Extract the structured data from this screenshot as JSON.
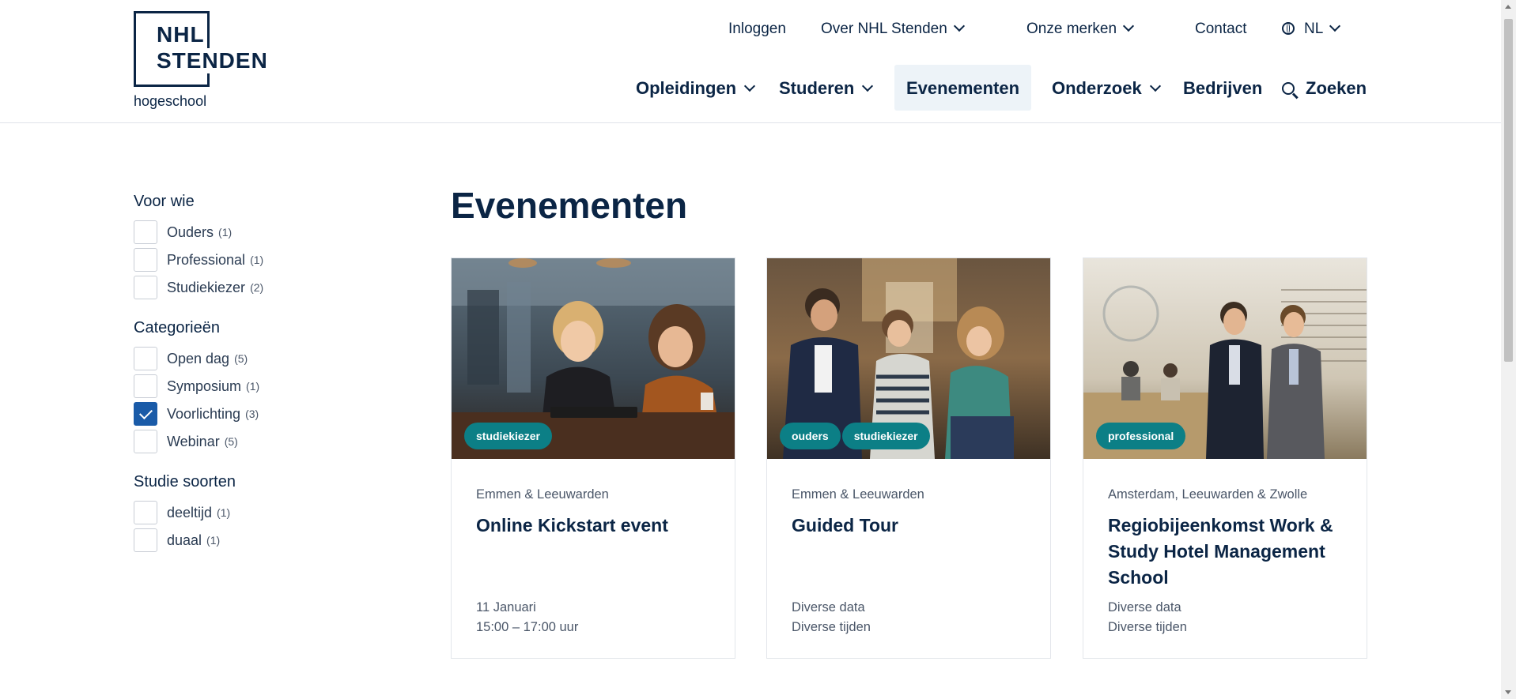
{
  "brand": {
    "line1": "NHL",
    "line2": "STENDEN",
    "sub": "hogeschool",
    "color": "#0b2545"
  },
  "topnav": {
    "login": "Inloggen",
    "about": "Over NHL Stenden",
    "brands": "Onze merken",
    "contact": "Contact",
    "language": "NL"
  },
  "mainnav": {
    "items": [
      {
        "label": "Opleidingen",
        "dropdown": true
      },
      {
        "label": "Studeren",
        "dropdown": true
      },
      {
        "label": "Evenementen",
        "active": true
      },
      {
        "label": "Onderzoek",
        "dropdown": true
      },
      {
        "label": "Bedrijven"
      }
    ],
    "search_label": "Zoeken"
  },
  "filters": [
    {
      "title": "Voor wie",
      "options": [
        {
          "label": "Ouders",
          "count": "(1)",
          "checked": false
        },
        {
          "label": "Professional",
          "count": "(1)",
          "checked": false
        },
        {
          "label": "Studiekiezer",
          "count": "(2)",
          "checked": false
        }
      ]
    },
    {
      "title": "Categorieën",
      "options": [
        {
          "label": "Open dag",
          "count": "(5)",
          "checked": false
        },
        {
          "label": "Symposium",
          "count": "(1)",
          "checked": false
        },
        {
          "label": "Voorlichting",
          "count": "(3)",
          "checked": true
        },
        {
          "label": "Webinar",
          "count": "(5)",
          "checked": false
        }
      ]
    },
    {
      "title": "Studie soorten",
      "options": [
        {
          "label": "deeltijd",
          "count": "(1)",
          "checked": false
        },
        {
          "label": "duaal",
          "count": "(1)",
          "checked": false
        }
      ]
    }
  ],
  "main": {
    "title": "Evenementen",
    "cards": [
      {
        "tags": [
          "studiekiezer"
        ],
        "location": "Emmen & Leeuwarden",
        "title": "Online Kickstart event",
        "date": "11 Januari",
        "time": "15:00 – 17:00 uur"
      },
      {
        "tags": [
          "ouders",
          "studiekiezer"
        ],
        "location": "Emmen & Leeuwarden",
        "title": "Guided Tour",
        "date": "Diverse data",
        "time": "Diverse tijden"
      },
      {
        "tags": [
          "professional"
        ],
        "location": "Amsterdam, Leeuwarden & Zwolle",
        "title": "Regiobijeenkomst Work & Study Hotel Management School",
        "date": "Diverse data",
        "time": "Diverse tijden"
      }
    ]
  },
  "colors": {
    "navy": "#0b2545",
    "tag": "#0c7f86",
    "checked": "#1a5ba8",
    "active_nav_bg": "#edf3f8"
  }
}
